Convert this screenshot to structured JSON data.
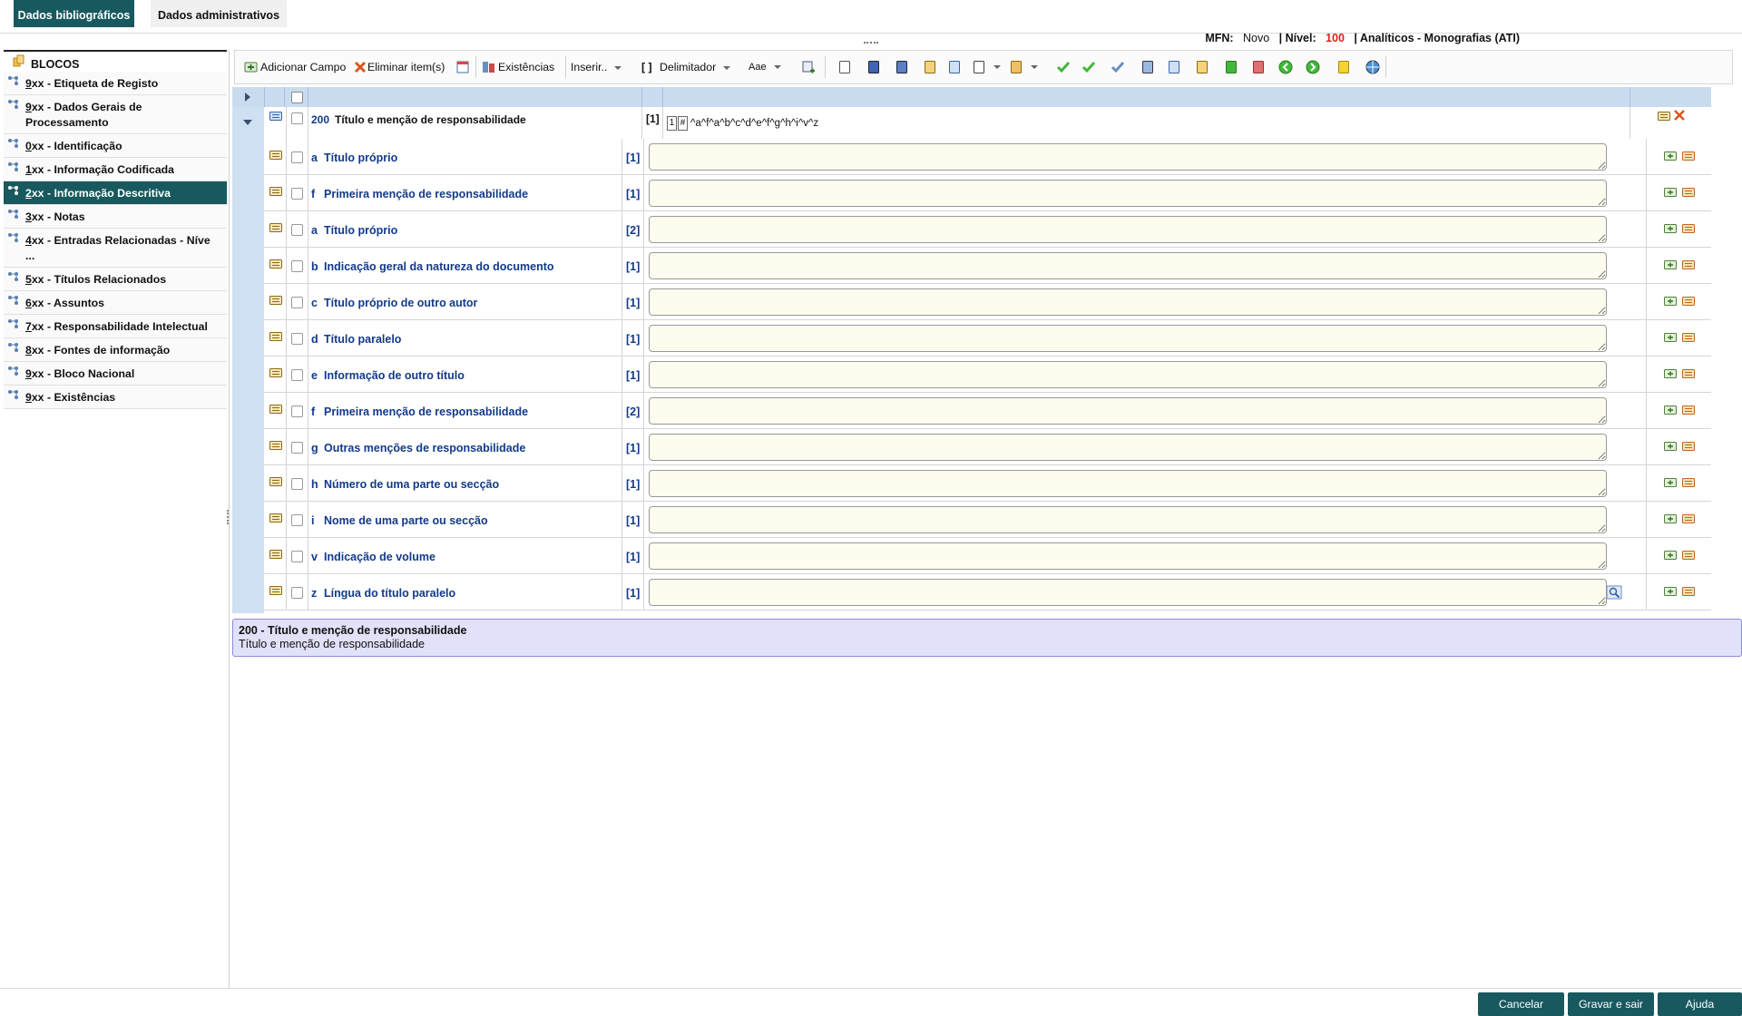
{
  "tabs": [
    {
      "label": "Dados bibliográficos",
      "active": true
    },
    {
      "label": "Dados administrativos",
      "active": false
    }
  ],
  "record_info": {
    "mfn_label": "MFN:",
    "mfn_value": "Novo",
    "nivel_label": "| Nível:",
    "nivel_value": "100",
    "type": "| Analíticos - Monografias (ATI)"
  },
  "sidebar": {
    "title": "BLOCOS",
    "items": [
      {
        "label": "9xx - Etiqueta de Registo"
      },
      {
        "label": "9xx - Dados Gerais de\nProcessamento"
      },
      {
        "label": "0xx - Identificação"
      },
      {
        "label": "1xx - Informação Codificada"
      },
      {
        "label": "2xx - Informação Descritiva",
        "selected": true
      },
      {
        "label": "3xx - Notas"
      },
      {
        "label": "4xx - Entradas Relacionadas - Níve\n..."
      },
      {
        "label": "5xx - Títulos Relacionados"
      },
      {
        "label": "6xx - Assuntos"
      },
      {
        "label": "7xx - Responsabilidade Intelectual"
      },
      {
        "label": "8xx - Fontes de informação"
      },
      {
        "label": "9xx - Bloco Nacional"
      },
      {
        "label": "9xx - Existências"
      }
    ]
  },
  "toolbar": {
    "add_field": "Adicionar Campo",
    "delete_items": "Eliminar item(s)",
    "holdings": "Existências",
    "insert": "Inserir..",
    "delimiter": "Delimitador",
    "case": "Aae"
  },
  "field": {
    "tag": "200",
    "label": "Título e menção de responsabilidade",
    "occurrence": "[1]",
    "ind1": "1",
    "ind2": "#",
    "subfields_pattern": "^a^f^a^b^c^d^e^f^g^h^i^v^z"
  },
  "subfields": [
    {
      "code": "a",
      "label": "Título próprio",
      "occ": "[1]"
    },
    {
      "code": "f",
      "label": "Primeira menção de responsabilidade",
      "occ": "[1]"
    },
    {
      "code": "a",
      "label": "Título próprio",
      "occ": "[2]"
    },
    {
      "code": "b",
      "label": "Indicação geral da natureza do documento",
      "occ": "[1]"
    },
    {
      "code": "c",
      "label": "Título próprio de outro autor",
      "occ": "[1]"
    },
    {
      "code": "d",
      "label": "Título paralelo",
      "occ": "[1]"
    },
    {
      "code": "e",
      "label": "Informação de outro título",
      "occ": "[1]"
    },
    {
      "code": "f",
      "label": "Primeira menção de responsabilidade",
      "occ": "[2]"
    },
    {
      "code": "g",
      "label": "Outras menções de responsabilidade",
      "occ": "[1]"
    },
    {
      "code": "h",
      "label": "Número de uma parte ou secção",
      "occ": "[1]"
    },
    {
      "code": "i",
      "label": "Nome de uma parte ou secção",
      "occ": "[1]"
    },
    {
      "code": "v",
      "label": "Indicação de volume",
      "occ": "[1]"
    },
    {
      "code": "z",
      "label": "Língua do título paralelo",
      "occ": "[1]"
    }
  ],
  "info_panel": {
    "title": "200 - Título e menção de responsabilidade",
    "description": "Título e menção de responsabilidade"
  },
  "footer": {
    "cancel": "Cancelar",
    "save_exit": "Gravar e sair",
    "help": "Ajuda"
  },
  "colors": {
    "primary": "#17595e",
    "grid_header": "#c9dcef",
    "subfield_text": "#123a8a",
    "nivel": "#e02020",
    "info_bg": "#e1e1f9"
  }
}
